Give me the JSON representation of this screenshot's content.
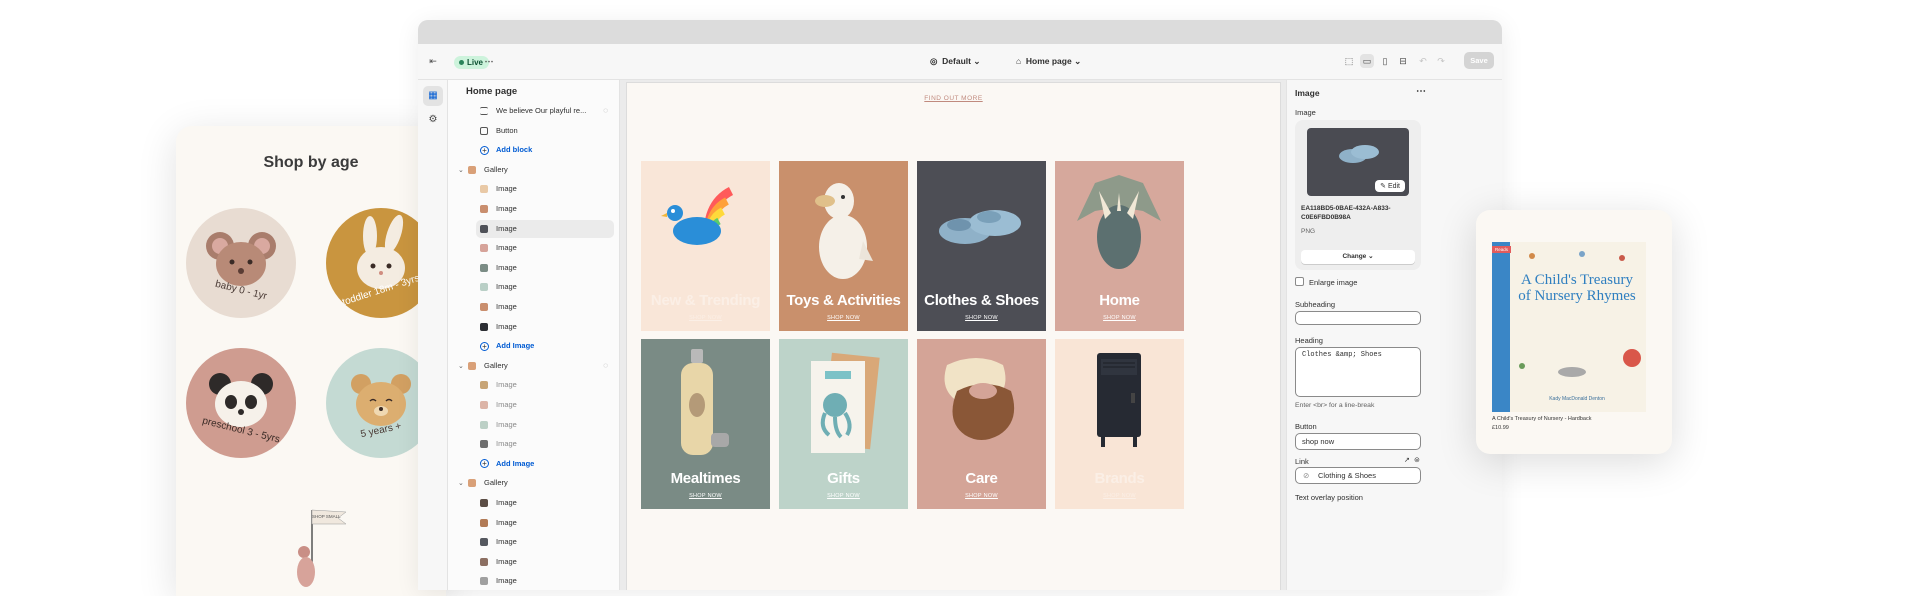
{
  "topbar": {
    "live": "Live",
    "theme": "Default",
    "page": "Home page",
    "save": "Save"
  },
  "sidebar": {
    "title": "Home page",
    "rows": [
      {
        "label": "We believe Our playful re...",
        "kind": "text",
        "hidden": true
      },
      {
        "label": "Button",
        "kind": "block"
      },
      {
        "label": "Add block",
        "kind": "add"
      },
      {
        "label": "Gallery",
        "kind": "section"
      },
      {
        "label": "Image",
        "kind": "block",
        "color": "#e9c9a6"
      },
      {
        "label": "Image",
        "kind": "block",
        "color": "#c98e6e"
      },
      {
        "label": "Image",
        "kind": "block",
        "color": "#4f5158",
        "selected": true
      },
      {
        "label": "Image",
        "kind": "block",
        "color": "#d6a39a"
      },
      {
        "label": "Image",
        "kind": "block",
        "color": "#7b8c85"
      },
      {
        "label": "Image",
        "kind": "block",
        "color": "#b9cfc6"
      },
      {
        "label": "Image",
        "kind": "block",
        "color": "#c98e6e"
      },
      {
        "label": "Image",
        "kind": "block",
        "color": "#2c2e33"
      },
      {
        "label": "Add Image",
        "kind": "add"
      },
      {
        "label": "Gallery",
        "kind": "section",
        "hidden": true
      },
      {
        "label": "Image",
        "kind": "block",
        "color": "#c7a476",
        "muted": true
      },
      {
        "label": "Image",
        "kind": "block",
        "color": "#dcb4a7",
        "muted": true
      },
      {
        "label": "Image",
        "kind": "block",
        "color": "#bcd0c6",
        "muted": true
      },
      {
        "label": "Image",
        "kind": "block",
        "color": "#6e6e6e",
        "muted": true
      },
      {
        "label": "Add Image",
        "kind": "add"
      },
      {
        "label": "Gallery",
        "kind": "section"
      },
      {
        "label": "Image",
        "kind": "block",
        "color": "#5b4d45"
      },
      {
        "label": "Image",
        "kind": "block",
        "color": "#b17a55"
      },
      {
        "label": "Image",
        "kind": "block",
        "color": "#55585f"
      },
      {
        "label": "Image",
        "kind": "block",
        "color": "#8c6f62"
      },
      {
        "label": "Image",
        "kind": "block",
        "color": "#a0a0a0"
      }
    ]
  },
  "canvas": {
    "find_more": "FIND OUT MORE",
    "tiles": [
      {
        "label": "New & Trending",
        "shop": "SHOP NOW",
        "bg": "#f9e6d8"
      },
      {
        "label": "Toys & Activities",
        "shop": "SHOP NOW",
        "bg": "#c9906c"
      },
      {
        "label": "Clothes & Shoes",
        "shop": "SHOP NOW",
        "bg": "#4d4e55"
      },
      {
        "label": "Home",
        "shop": "SHOP NOW",
        "bg": "#d6a89c"
      },
      {
        "label": "Mealtimes",
        "shop": "SHOP NOW",
        "bg": "#7a8b85"
      },
      {
        "label": "Gifts",
        "shop": "SHOP NOW",
        "bg": "#bdd3c9"
      },
      {
        "label": "Care",
        "shop": "SHOP NOW",
        "bg": "#d4a497"
      },
      {
        "label": "Brands",
        "shop": "SHOP NOW",
        "bg": "#f9e5d6"
      }
    ]
  },
  "settings": {
    "title": "Image",
    "image_label": "Image",
    "edit": "Edit",
    "filename": "EA118BD5-0BAE-432A-A833-C0E6FBD0B98A",
    "filetype": "PNG",
    "change": "Change",
    "enlarge": "Enlarge image",
    "subheading_label": "Subheading",
    "subheading_value": "",
    "heading_label": "Heading",
    "heading_value": "Clothes &amp; Shoes",
    "heading_hint": "Enter <br> for a line-break",
    "button_label": "Button",
    "button_value": "shop now",
    "link_label": "Link",
    "link_value": "Clothing & Shoes",
    "overlay_label": "Text overlay position"
  },
  "age_card": {
    "title": "Shop by age",
    "circles": [
      {
        "label": "baby 0 - 1yr",
        "bg": "#e8dcd2",
        "animal": "mouse"
      },
      {
        "label": "toddler 18m - 3yrs",
        "bg": "#c9953f",
        "animal": "rabbit"
      },
      {
        "label": "preschool 3 - 5yrs",
        "bg": "#cf9c90",
        "animal": "panda"
      },
      {
        "label": "5 years +",
        "bg": "#c4dad3",
        "animal": "bear"
      }
    ],
    "flag": "SHOP SMALL"
  },
  "book_card": {
    "badge": "Reads",
    "cover_title": "A Child's Treasury of Nursery Rhymes",
    "cover_author": "Kady MacDonald Denton",
    "product_name": "A Child's Treasury of Nursery - Hardback",
    "price": "£10.99"
  }
}
